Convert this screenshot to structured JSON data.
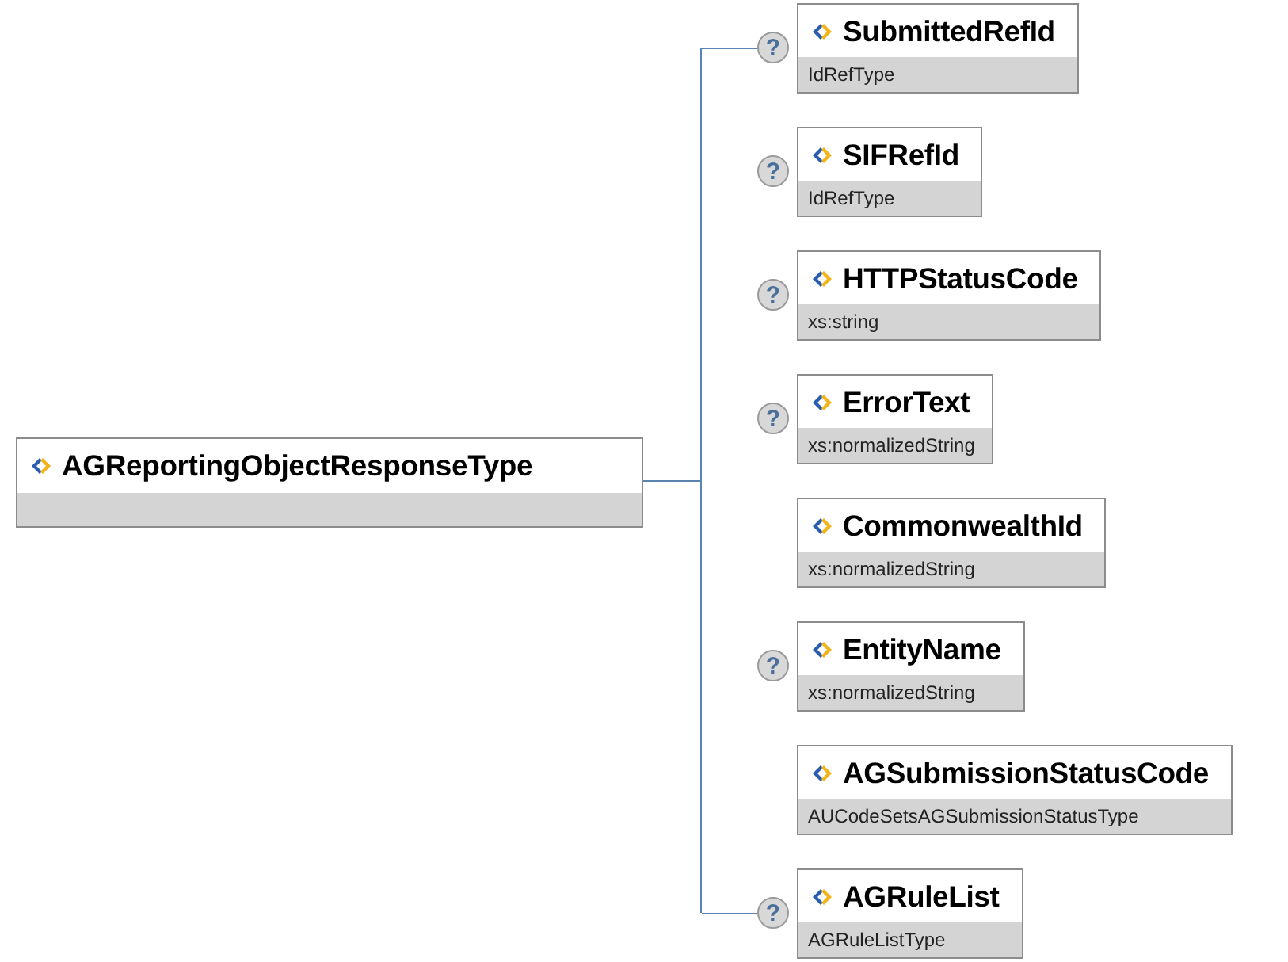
{
  "root": {
    "name": "AGReportingObjectResponseType"
  },
  "children": [
    {
      "name": "SubmittedRefId",
      "type": "IdRefType",
      "optional_marker": "?"
    },
    {
      "name": "SIFRefId",
      "type": "IdRefType",
      "optional_marker": "?"
    },
    {
      "name": "HTTPStatusCode",
      "type": "xs:string",
      "optional_marker": "?"
    },
    {
      "name": "ErrorText",
      "type": "xs:normalizedString",
      "optional_marker": "?"
    },
    {
      "name": "CommonwealthId",
      "type": "xs:normalizedString"
    },
    {
      "name": "EntityName",
      "type": "xs:normalizedString",
      "optional_marker": "?"
    },
    {
      "name": "AGSubmissionStatusCode",
      "type": "AUCodeSetsAGSubmissionStatusType"
    },
    {
      "name": "AGRuleList",
      "type": "AGRuleListType",
      "optional_marker": "?"
    }
  ]
}
